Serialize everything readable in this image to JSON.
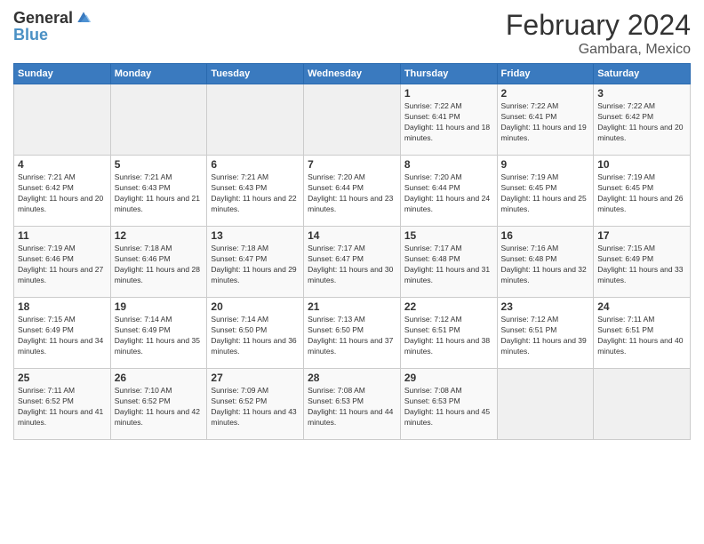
{
  "header": {
    "logo_general": "General",
    "logo_blue": "Blue",
    "title": "February 2024",
    "location": "Gambara, Mexico"
  },
  "days_of_week": [
    "Sunday",
    "Monday",
    "Tuesday",
    "Wednesday",
    "Thursday",
    "Friday",
    "Saturday"
  ],
  "weeks": [
    [
      {
        "day": "",
        "info": ""
      },
      {
        "day": "",
        "info": ""
      },
      {
        "day": "",
        "info": ""
      },
      {
        "day": "",
        "info": ""
      },
      {
        "day": "1",
        "info": "Sunrise: 7:22 AM\nSunset: 6:41 PM\nDaylight: 11 hours and 18 minutes."
      },
      {
        "day": "2",
        "info": "Sunrise: 7:22 AM\nSunset: 6:41 PM\nDaylight: 11 hours and 19 minutes."
      },
      {
        "day": "3",
        "info": "Sunrise: 7:22 AM\nSunset: 6:42 PM\nDaylight: 11 hours and 20 minutes."
      }
    ],
    [
      {
        "day": "4",
        "info": "Sunrise: 7:21 AM\nSunset: 6:42 PM\nDaylight: 11 hours and 20 minutes."
      },
      {
        "day": "5",
        "info": "Sunrise: 7:21 AM\nSunset: 6:43 PM\nDaylight: 11 hours and 21 minutes."
      },
      {
        "day": "6",
        "info": "Sunrise: 7:21 AM\nSunset: 6:43 PM\nDaylight: 11 hours and 22 minutes."
      },
      {
        "day": "7",
        "info": "Sunrise: 7:20 AM\nSunset: 6:44 PM\nDaylight: 11 hours and 23 minutes."
      },
      {
        "day": "8",
        "info": "Sunrise: 7:20 AM\nSunset: 6:44 PM\nDaylight: 11 hours and 24 minutes."
      },
      {
        "day": "9",
        "info": "Sunrise: 7:19 AM\nSunset: 6:45 PM\nDaylight: 11 hours and 25 minutes."
      },
      {
        "day": "10",
        "info": "Sunrise: 7:19 AM\nSunset: 6:45 PM\nDaylight: 11 hours and 26 minutes."
      }
    ],
    [
      {
        "day": "11",
        "info": "Sunrise: 7:19 AM\nSunset: 6:46 PM\nDaylight: 11 hours and 27 minutes."
      },
      {
        "day": "12",
        "info": "Sunrise: 7:18 AM\nSunset: 6:46 PM\nDaylight: 11 hours and 28 minutes."
      },
      {
        "day": "13",
        "info": "Sunrise: 7:18 AM\nSunset: 6:47 PM\nDaylight: 11 hours and 29 minutes."
      },
      {
        "day": "14",
        "info": "Sunrise: 7:17 AM\nSunset: 6:47 PM\nDaylight: 11 hours and 30 minutes."
      },
      {
        "day": "15",
        "info": "Sunrise: 7:17 AM\nSunset: 6:48 PM\nDaylight: 11 hours and 31 minutes."
      },
      {
        "day": "16",
        "info": "Sunrise: 7:16 AM\nSunset: 6:48 PM\nDaylight: 11 hours and 32 minutes."
      },
      {
        "day": "17",
        "info": "Sunrise: 7:15 AM\nSunset: 6:49 PM\nDaylight: 11 hours and 33 minutes."
      }
    ],
    [
      {
        "day": "18",
        "info": "Sunrise: 7:15 AM\nSunset: 6:49 PM\nDaylight: 11 hours and 34 minutes."
      },
      {
        "day": "19",
        "info": "Sunrise: 7:14 AM\nSunset: 6:49 PM\nDaylight: 11 hours and 35 minutes."
      },
      {
        "day": "20",
        "info": "Sunrise: 7:14 AM\nSunset: 6:50 PM\nDaylight: 11 hours and 36 minutes."
      },
      {
        "day": "21",
        "info": "Sunrise: 7:13 AM\nSunset: 6:50 PM\nDaylight: 11 hours and 37 minutes."
      },
      {
        "day": "22",
        "info": "Sunrise: 7:12 AM\nSunset: 6:51 PM\nDaylight: 11 hours and 38 minutes."
      },
      {
        "day": "23",
        "info": "Sunrise: 7:12 AM\nSunset: 6:51 PM\nDaylight: 11 hours and 39 minutes."
      },
      {
        "day": "24",
        "info": "Sunrise: 7:11 AM\nSunset: 6:51 PM\nDaylight: 11 hours and 40 minutes."
      }
    ],
    [
      {
        "day": "25",
        "info": "Sunrise: 7:11 AM\nSunset: 6:52 PM\nDaylight: 11 hours and 41 minutes."
      },
      {
        "day": "26",
        "info": "Sunrise: 7:10 AM\nSunset: 6:52 PM\nDaylight: 11 hours and 42 minutes."
      },
      {
        "day": "27",
        "info": "Sunrise: 7:09 AM\nSunset: 6:52 PM\nDaylight: 11 hours and 43 minutes."
      },
      {
        "day": "28",
        "info": "Sunrise: 7:08 AM\nSunset: 6:53 PM\nDaylight: 11 hours and 44 minutes."
      },
      {
        "day": "29",
        "info": "Sunrise: 7:08 AM\nSunset: 6:53 PM\nDaylight: 11 hours and 45 minutes."
      },
      {
        "day": "",
        "info": ""
      },
      {
        "day": "",
        "info": ""
      }
    ]
  ]
}
